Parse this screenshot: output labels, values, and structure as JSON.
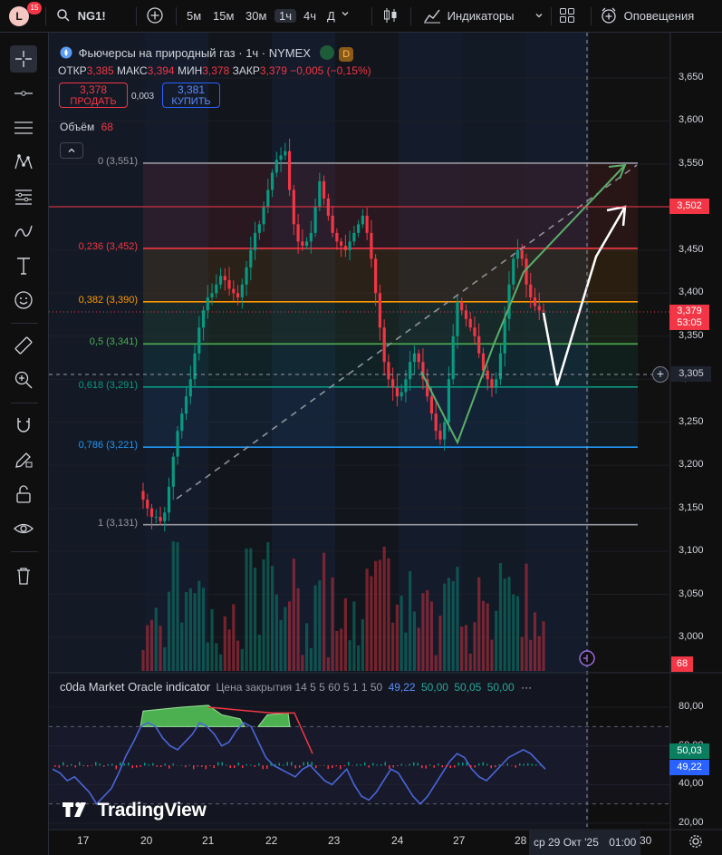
{
  "topbar": {
    "avatar_letter": "L",
    "avatar_badge": "15",
    "symbol": "NG1!",
    "timeframes": [
      "5м",
      "15м",
      "30м",
      "1ч",
      "4ч",
      "Д"
    ],
    "active_timeframe": "1ч",
    "indicators_label": "Индикаторы",
    "alerts_label": "Оповещения"
  },
  "legend": {
    "title": "Фьючерсы на природный газ · 1ч · NYMEX",
    "badge": "D",
    "ohlc": {
      "open_label": "ОТКР",
      "open": "3,385",
      "high_label": "МАКС",
      "high": "3,394",
      "low_label": "МИН",
      "low": "3,378",
      "close_label": "ЗАКР",
      "close": "3,379",
      "change": "−0,005 (−0,15%)"
    },
    "sell_price": "3,378",
    "sell_label": "ПРОДАТЬ",
    "spread": "0,003",
    "buy_price": "3,381",
    "buy_label": "КУПИТЬ",
    "volume_label": "Объём",
    "volume_value": "68"
  },
  "price_axis": {
    "labels": [
      "3,650",
      "3,600",
      "3,550",
      "3,500",
      "3,450",
      "3,400",
      "3,350",
      "3,300",
      "3,250",
      "3,200",
      "3,150",
      "3,100",
      "3,050",
      "3,000"
    ],
    "tag_level": "3,502",
    "tag_current": "3,379",
    "tag_countdown": "53:05",
    "tag_crosshair": "3,305",
    "tag_volume": "68"
  },
  "fib_levels": [
    {
      "label": "0 (3,551)",
      "color": "#9598a1"
    },
    {
      "label": "0,236 (3,452)",
      "color": "#f23645"
    },
    {
      "label": "0,382 (3,390)",
      "color": "#ff9800"
    },
    {
      "label": "0,5 (3,341)",
      "color": "#4caf50"
    },
    {
      "label": "0,618 (3,291)",
      "color": "#089981"
    },
    {
      "label": "0,786 (3,221)",
      "color": "#2196f3"
    },
    {
      "label": "1 (3,131)",
      "color": "#9598a1"
    }
  ],
  "indicator": {
    "name": "c0da Market Oracle indicator",
    "params": "Цена закрытия 14 5 5 60 5 1 1 50",
    "v1": "49,22",
    "v2": "50,00",
    "v3": "50,05",
    "v4": "50,00",
    "axis_labels": [
      "80,00",
      "60,00",
      "40,00",
      "20,00"
    ],
    "tag_a": "50,03",
    "tag_b": "49,22"
  },
  "time_axis": {
    "labels": [
      "17",
      "20",
      "21",
      "22",
      "23",
      "24",
      "27",
      "28"
    ],
    "crosshair_label": "ср 29 Окт '25",
    "crosshair_time": "01:00",
    "tail": "30"
  },
  "watermark": "TradingView",
  "colors": {
    "up": "#089981",
    "down": "#f23645",
    "accent": "#2962ff"
  },
  "chart_data": {
    "type": "candlestick",
    "price_range": [
      2.98,
      3.67
    ],
    "closes": [
      3.16,
      3.15,
      3.14,
      3.14,
      3.135,
      3.145,
      3.175,
      3.21,
      3.24,
      3.26,
      3.28,
      3.3,
      3.33,
      3.36,
      3.38,
      3.395,
      3.4,
      3.41,
      3.42,
      3.415,
      3.405,
      3.4,
      3.395,
      3.41,
      3.43,
      3.45,
      3.47,
      3.48,
      3.5,
      3.52,
      3.54,
      3.555,
      3.56,
      3.565,
      3.52,
      3.48,
      3.46,
      3.455,
      3.46,
      3.47,
      3.5,
      3.53,
      3.51,
      3.49,
      3.47,
      3.46,
      3.455,
      3.45,
      3.46,
      3.47,
      3.48,
      3.49,
      3.47,
      3.44,
      3.4,
      3.36,
      3.32,
      3.3,
      3.29,
      3.28,
      3.285,
      3.3,
      3.32,
      3.33,
      3.32,
      3.3,
      3.28,
      3.26,
      3.24,
      3.23,
      3.25,
      3.3,
      3.35,
      3.39,
      3.38,
      3.37,
      3.36,
      3.35,
      3.33,
      3.31,
      3.3,
      3.29,
      3.3,
      3.33,
      3.37,
      3.41,
      3.44,
      3.45,
      3.44,
      3.41,
      3.395,
      3.385,
      3.38,
      3.379
    ]
  }
}
